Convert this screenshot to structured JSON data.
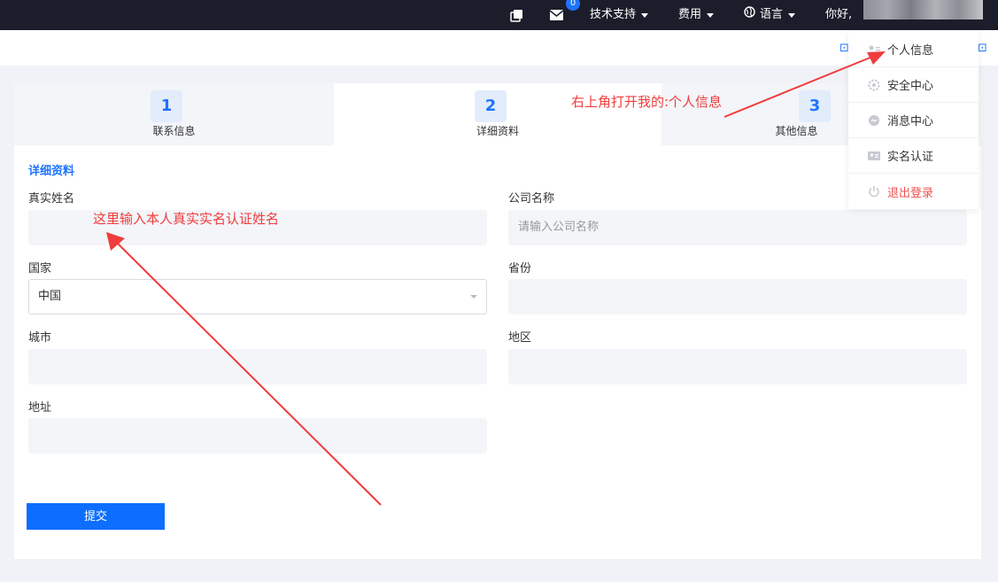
{
  "topbar": {
    "badge_count": "0",
    "tech_support": "技术支持",
    "fees": "费用",
    "language": "语言",
    "greeting": "你好,"
  },
  "steps": [
    {
      "num": "1",
      "label": "联系信息"
    },
    {
      "num": "2",
      "label": "详细资料"
    },
    {
      "num": "3",
      "label": "其他信息"
    }
  ],
  "form": {
    "section_title": "详细资料",
    "real_name_label": "真实姓名",
    "real_name_value": "",
    "company_label": "公司名称",
    "company_placeholder": "请输入公司名称",
    "country_label": "国家",
    "country_value": "中国",
    "province_label": "省份",
    "city_label": "城市",
    "district_label": "地区",
    "address_label": "地址",
    "submit_label": "提交"
  },
  "dropdown": {
    "items": [
      {
        "label": "个人信息",
        "icon": "user-card-icon"
      },
      {
        "label": "安全中心",
        "icon": "gear-icon"
      },
      {
        "label": "消息中心",
        "icon": "message-icon"
      },
      {
        "label": "实名认证",
        "icon": "id-card-icon"
      },
      {
        "label": "退出登录",
        "icon": "power-icon"
      }
    ]
  },
  "annotations": {
    "top_right": "右上角打开我的:个人信息",
    "name_hint": "这里输入本人真实实名认证姓名"
  },
  "colors": {
    "accent": "#1e74ff",
    "topbar": "#1c1d2b",
    "annotation": "#f03c3c",
    "danger": "#f05050"
  }
}
